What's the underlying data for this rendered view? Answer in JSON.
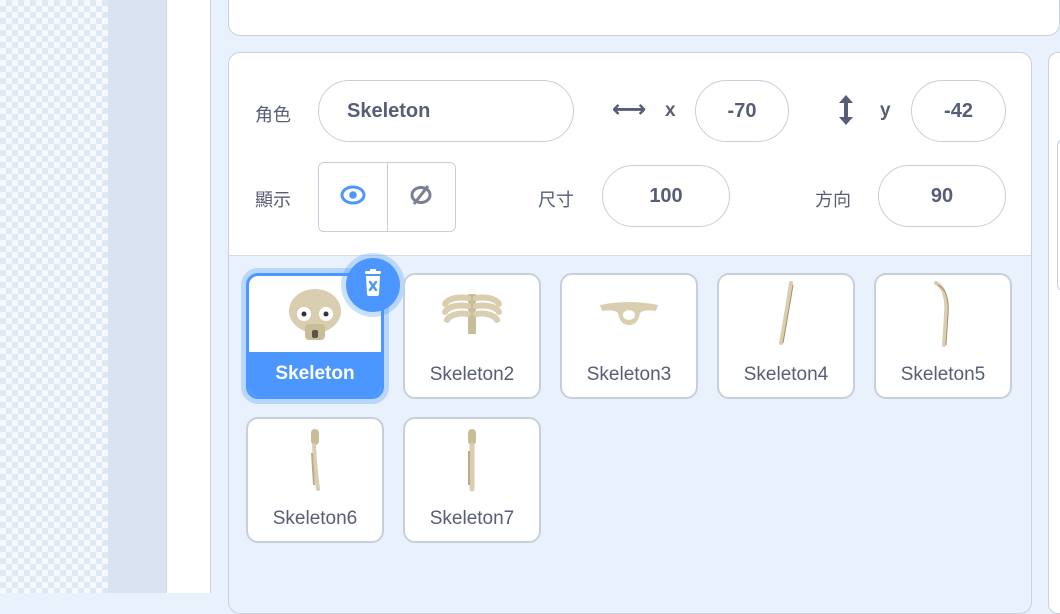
{
  "sprite_info": {
    "sprite_label": "角色",
    "sprite_name": "Skeleton",
    "x_label": "x",
    "x_value": "-70",
    "y_label": "y",
    "y_value": "-42",
    "show_label": "顯示",
    "size_label": "尺寸",
    "size_value": "100",
    "direction_label": "方向",
    "direction_value": "90",
    "x_icon": "left-right-arrow-icon",
    "y_icon": "up-down-arrow-icon",
    "show_icon": "eye-icon",
    "hide_icon": "eye-slash-icon"
  },
  "sprites": [
    {
      "name": "Skeleton",
      "selected": true,
      "thumb": "skull"
    },
    {
      "name": "Skeleton2",
      "selected": false,
      "thumb": "ribcage"
    },
    {
      "name": "Skeleton3",
      "selected": false,
      "thumb": "pelvis"
    },
    {
      "name": "Skeleton4",
      "selected": false,
      "thumb": "arm-bone"
    },
    {
      "name": "Skeleton5",
      "selected": false,
      "thumb": "curved-bone"
    },
    {
      "name": "Skeleton6",
      "selected": false,
      "thumb": "leg-bone"
    },
    {
      "name": "Skeleton7",
      "selected": false,
      "thumb": "leg-bone"
    }
  ],
  "delete_icon": "trash-icon",
  "colors": {
    "accent": "#4c97ff",
    "text": "#575e75",
    "bone": "#d9cfb0"
  }
}
